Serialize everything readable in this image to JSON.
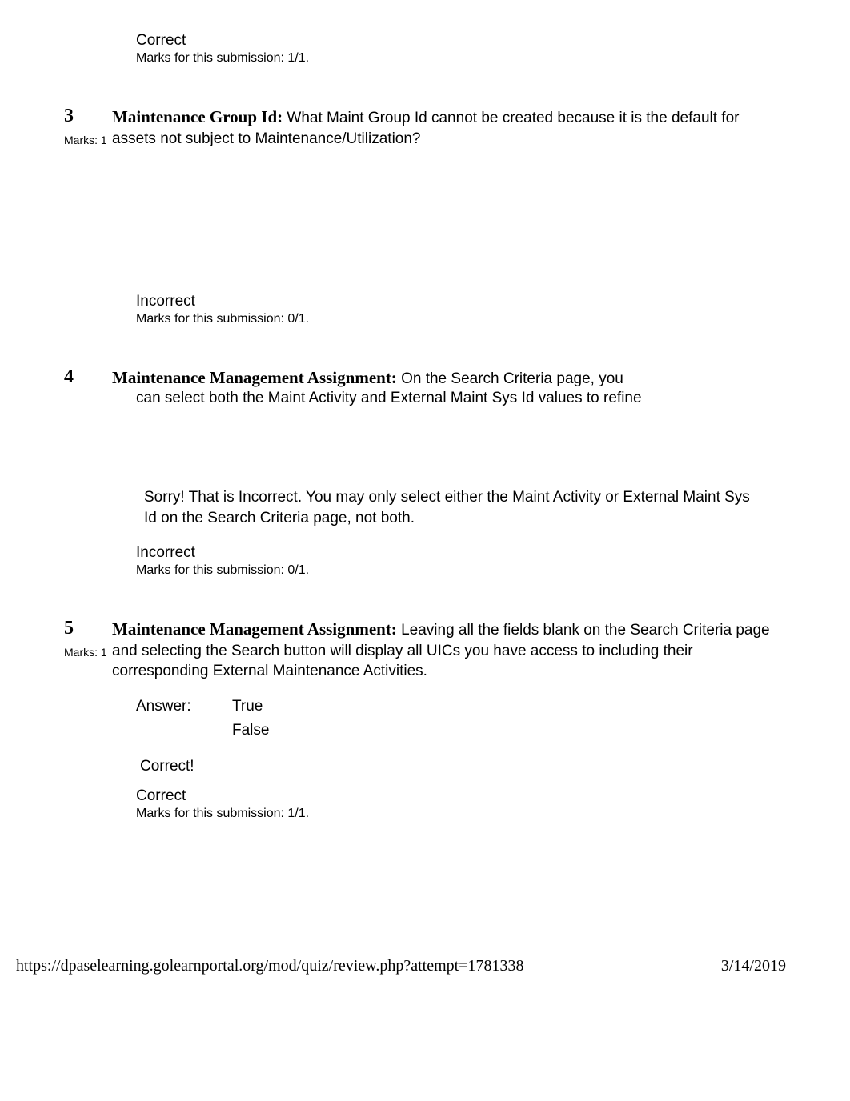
{
  "q2_footer": {
    "status": "Correct",
    "marks": "Marks for this submission: 1/1."
  },
  "q3": {
    "number": "3",
    "marks_label": "Marks: 1",
    "title": "Maintenance Group Id:",
    "body": "  What Maint Group Id cannot be created because it is the default for assets not subject to Maintenance/Utilization?",
    "status": "Incorrect",
    "marks": "Marks for this submission: 0/1."
  },
  "q4": {
    "number": "4",
    "title": "Maintenance Management Assignment:",
    "body": "    On the Search Criteria page, you",
    "truncated": "can select both the Maint Activity and External Maint Sys Id values to refine",
    "feedback": "Sorry! That is Incorrect. You may only select either the Maint Activity or External Maint Sys Id on the Search Criteria page, not both.",
    "status": "Incorrect",
    "marks": "Marks for this submission: 0/1."
  },
  "q5": {
    "number": "5",
    "marks_label": "Marks: 1",
    "title": "Maintenance Management Assignment:",
    "body": "    Leaving all the fields blank on the Search Criteria page and selecting the Search button will display all UICs you have access to including their corresponding External Maintenance Activities.",
    "answer_label": "Answer:",
    "option_true": "True",
    "option_false": "False",
    "feedback": "Correct!",
    "status": "Correct",
    "marks": "Marks for this submission: 1/1."
  },
  "footer": {
    "url": "https://dpaselearning.golearnportal.org/mod/quiz/review.php?attempt=1781338",
    "date": "3/14/2019"
  }
}
